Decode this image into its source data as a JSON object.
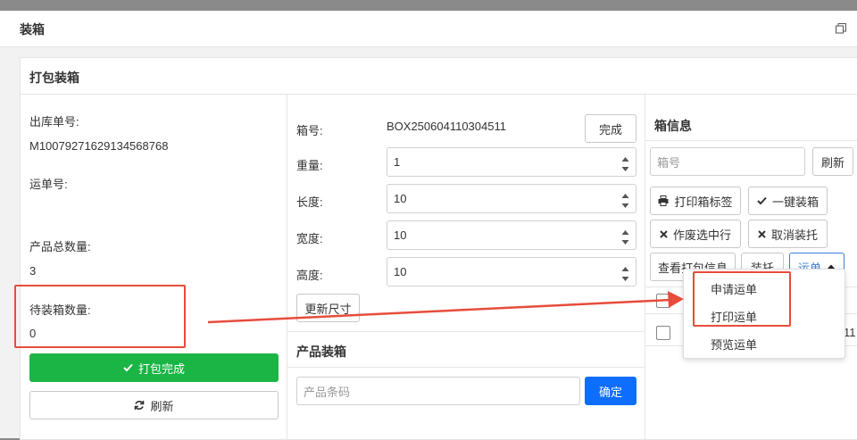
{
  "window": {
    "title": "装箱",
    "restore_icon": "restore-window-icon"
  },
  "panel": {
    "title": "打包装箱"
  },
  "left": {
    "outbound_no_label": "出库单号:",
    "outbound_no_value": "M10079271629134568768",
    "waybill_no_label": "运单号:",
    "waybill_no_value": "",
    "total_qty_label": "产品总数量:",
    "total_qty_value": "3",
    "pending_qty_label": "待装箱数量:",
    "pending_qty_value": "0",
    "pack_done_button": "打包完成",
    "refresh_button": "刷新"
  },
  "middle": {
    "box_no_label": "箱号:",
    "box_no_value": "BOX250604110304511",
    "complete_button": "完成",
    "weight_label": "重量:",
    "weight_value": "1",
    "length_label": "长度:",
    "length_value": "10",
    "width_label": "宽度:",
    "width_value": "10",
    "height_label": "高度:",
    "height_value": "10",
    "update_size_button": "更新尺寸",
    "product_section_title": "产品装箱",
    "barcode_placeholder": "产品条码",
    "confirm_button": "确定"
  },
  "right": {
    "title": "箱信息",
    "box_no_placeholder": "箱号",
    "refresh_button": "刷新",
    "print_label_button": "打印箱标签",
    "one_click_pack_button": "一键装箱",
    "void_selected_button": "作废选中行",
    "cancel_pallet_button": "取消装托",
    "view_pack_info_button": "查看打包信息",
    "pallet_button": "装托",
    "waybill_button": "运单",
    "row_partial_text": "11"
  },
  "dropdown": {
    "items": [
      "申请运单",
      "打印运单",
      "预览运单"
    ]
  },
  "colors": {
    "green": "#1bb546",
    "blue": "#0d6efd",
    "annotation_red": "#e74c3c"
  }
}
